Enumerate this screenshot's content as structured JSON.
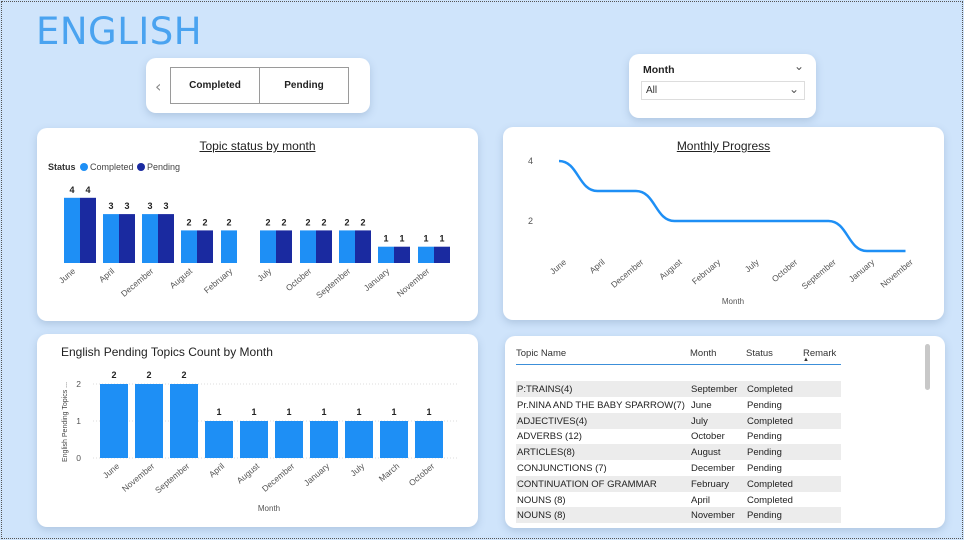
{
  "page": {
    "title": "ENGLISH"
  },
  "status_slicer": {
    "tiles": [
      "Completed",
      "Pending"
    ]
  },
  "month_slicer": {
    "label": "Month",
    "value": "All"
  },
  "colors": {
    "completed": "#1e8ff5",
    "pending": "#1a2aa0",
    "accent": "#4aa3f0"
  },
  "chart_data": [
    {
      "type": "bar",
      "title": "Topic status by month",
      "legend_title": "Status",
      "legend_position": "top-left",
      "categories": [
        "June",
        "April",
        "December",
        "August",
        "February",
        "July",
        "October",
        "September",
        "January",
        "November"
      ],
      "series": [
        {
          "name": "Completed",
          "values": [
            4,
            3,
            3,
            2,
            2,
            2,
            2,
            2,
            1,
            1
          ]
        },
        {
          "name": "Pending",
          "values": [
            4,
            3,
            3,
            2,
            null,
            2,
            2,
            2,
            1,
            1
          ]
        }
      ]
    },
    {
      "type": "line",
      "title": "Monthly Progress",
      "xlabel": "Month",
      "x": [
        "June",
        "April",
        "December",
        "August",
        "February",
        "July",
        "October",
        "September",
        "January",
        "November"
      ],
      "values": [
        4,
        3,
        3,
        2,
        2,
        2,
        2,
        2,
        1,
        1
      ],
      "ytick_labels": [
        "4",
        "2"
      ]
    },
    {
      "type": "bar",
      "title": "English Pending Topics Count by Month",
      "xlabel": "Month",
      "ylabel": "English Pending Topics ...",
      "ylim": [
        0,
        2
      ],
      "ytick_labels": [
        "2",
        "1",
        "0"
      ],
      "categories": [
        "June",
        "November",
        "September",
        "April",
        "August",
        "December",
        "January",
        "July",
        "March",
        "October"
      ],
      "values": [
        2,
        2,
        2,
        1,
        1,
        1,
        1,
        1,
        1,
        1
      ]
    }
  ],
  "table": {
    "columns": [
      "Topic Name",
      "Month",
      "Status",
      "Remark"
    ],
    "rows": [
      [
        "P:TRAINS(4)",
        "September",
        "Completed"
      ],
      [
        "Pr.NINA AND THE BABY SPARROW(7)",
        "June",
        "Pending"
      ],
      [
        "ADJECTIVES(4)",
        "July",
        "Completed"
      ],
      [
        "ADVERBS (12)",
        "October",
        "Pending"
      ],
      [
        "ARTICLES(8)",
        "August",
        "Pending"
      ],
      [
        "CONJUNCTIONS (7)",
        "December",
        "Pending"
      ],
      [
        "CONTINUATION OF GRAMMAR",
        "February",
        "Completed"
      ],
      [
        "NOUNS (8)",
        "April",
        "Completed"
      ],
      [
        "NOUNS (8)",
        "November",
        "Pending"
      ]
    ]
  }
}
